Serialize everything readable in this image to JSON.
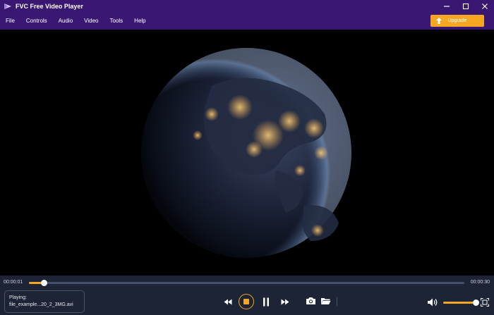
{
  "window": {
    "title": "FVC Free Video Player",
    "accent": "#3a1772",
    "highlight": "#f5a623"
  },
  "menu": {
    "items": [
      "File",
      "Controls",
      "Audio",
      "Video",
      "Tools",
      "Help"
    ],
    "upgrade_label": "Upgrade"
  },
  "player": {
    "current_time": "00:00:01",
    "total_time": "00:00:30",
    "progress_fraction": 0.034,
    "volume_fraction": 0.98,
    "playing_label": "Playing:",
    "file_name": "file_example...20_2_3MG.avi"
  },
  "icons": {
    "logo": "play-logo-icon",
    "rewind": "rewind-icon",
    "stop": "stop-icon",
    "pause": "pause-icon",
    "forward": "fast-forward-icon",
    "snapshot": "camera-icon",
    "open": "folder-icon",
    "volume": "speaker-icon",
    "fullscreen": "fullscreen-icon"
  }
}
